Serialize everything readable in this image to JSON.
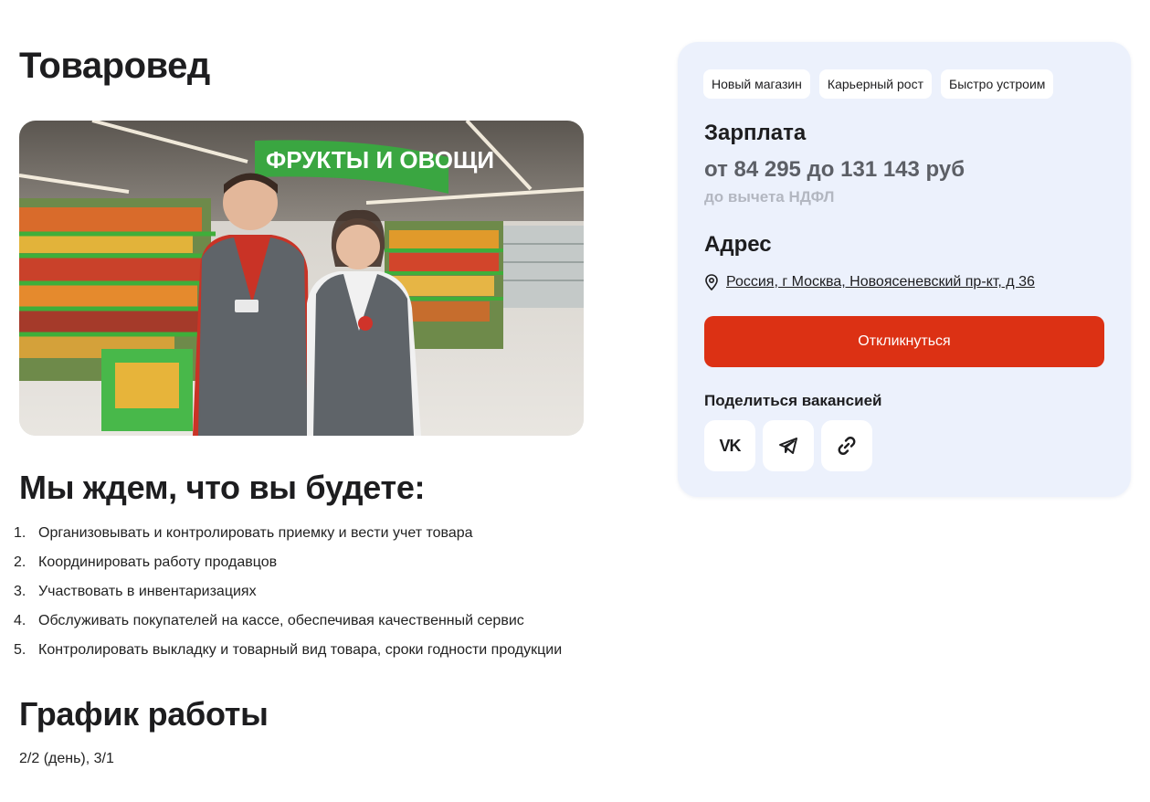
{
  "page": {
    "title": "Товаровед"
  },
  "duties": {
    "title": "Мы ждем, что вы будете:",
    "items": [
      {
        "num": "1.",
        "text": "Организовывать и контролировать приемку и вести учет товара"
      },
      {
        "num": "2.",
        "text": "Координировать работу продавцов"
      },
      {
        "num": "3.",
        "text": "Участвовать в инвентаризациях"
      },
      {
        "num": "4.",
        "text": "Обслуживать покупателей на кассе, обеспечивая качественный сервис"
      },
      {
        "num": "5.",
        "text": "Контролировать выкладку и товарный вид товара, сроки годности продукции"
      }
    ]
  },
  "schedule": {
    "title": "График работы",
    "value": "2/2 (день), 3/1"
  },
  "photo": {
    "sign_text": "ФРУКТЫ И ОВОЩИ"
  },
  "card": {
    "tags": [
      "Новый магазин",
      "Карьерный рост",
      "Быстро устроим"
    ],
    "salary_title": "Зарплата",
    "salary_value": "от 84 295 до 131 143 руб",
    "salary_note": "до вычета НДФЛ",
    "address_title": "Адрес",
    "address_value": "Россия, г Москва, Новоясеневский пр-кт, д 36",
    "apply_label": "Откликнуться",
    "share_title": "Поделиться вакансией",
    "share_vk_label": "VK",
    "accent_color": "#dc3114",
    "card_bg": "#ecf1fc"
  }
}
